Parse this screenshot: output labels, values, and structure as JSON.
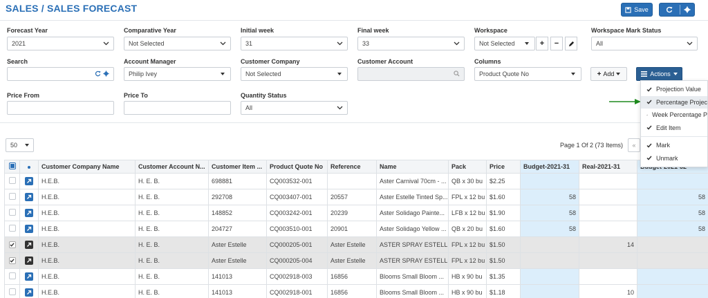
{
  "header": {
    "title": "SALES / SALES FORECAST",
    "save_label": "Save"
  },
  "filters": {
    "forecast_year": {
      "label": "Forecast Year",
      "value": "2021"
    },
    "comparative_year": {
      "label": "Comparative Year",
      "value": "Not Selected"
    },
    "initial_week": {
      "label": "Initial week",
      "value": "31"
    },
    "final_week": {
      "label": "Final week",
      "value": "33"
    },
    "workspace": {
      "label": "Workspace",
      "value": "Not Selected"
    },
    "workspace_mark_status": {
      "label": "Workspace Mark Status",
      "value": "All"
    },
    "search": {
      "label": "Search",
      "value": ""
    },
    "account_manager": {
      "label": "Account Manager",
      "value": "Philip Ivey"
    },
    "customer_company": {
      "label": "Customer Company",
      "value": "Not Selected"
    },
    "customer_account": {
      "label": "Customer Account",
      "value": ""
    },
    "columns": {
      "label": "Columns",
      "value": "Product Quote No"
    },
    "price_from": {
      "label": "Price From",
      "value": ""
    },
    "price_to": {
      "label": "Price To",
      "value": ""
    },
    "quantity_status": {
      "label": "Quantity Status",
      "value": "All"
    }
  },
  "toolbar": {
    "add_label": "Add",
    "actions_label": "Actions"
  },
  "actions_menu": {
    "items": [
      "Projection Value",
      "Percentage Projec",
      "Week Percentage P",
      "Edit Item",
      "Mark",
      "Unmark"
    ]
  },
  "pagination": {
    "page_size": "50",
    "page_info": "Page 1 Of 2 (73 Items)",
    "first_label": "«"
  },
  "table": {
    "headers": [
      "Customer Company Name",
      "Customer Account N...",
      "Customer Item ...",
      "Product Quote No",
      "Reference",
      "Name",
      "Pack",
      "Price",
      "Budget-2021-31",
      "Real-2021-31",
      "Budget-2021-32"
    ],
    "rows": [
      {
        "company": "H.E.B.",
        "account": "H. E. B.",
        "item": "698881",
        "quote": "CQ003532-001",
        "reference": "",
        "name": "Aster Carnival 70cm - ...",
        "pack": "QB x 30 bu",
        "price": "$2.25",
        "budget31": "",
        "real31": "",
        "budget32": ""
      },
      {
        "company": "H.E.B.",
        "account": "H. E. B.",
        "item": "292708",
        "quote": "CQ003407-001",
        "reference": "20557",
        "name": "Aster Estelle Tinted Sp...",
        "pack": "FPL x 12 bu",
        "price": "$1.60",
        "budget31": "58",
        "real31": "",
        "budget32": "58"
      },
      {
        "company": "H.E.B.",
        "account": "H. E. B.",
        "item": "148852",
        "quote": "CQ003242-001",
        "reference": "20239",
        "name": "Aster Solidago Painte...",
        "pack": "LFB x 12 bu",
        "price": "$1.90",
        "budget31": "58",
        "real31": "",
        "budget32": "58"
      },
      {
        "company": "H.E.B.",
        "account": "H. E. B.",
        "item": "204727",
        "quote": "CQ003510-001",
        "reference": "20901",
        "name": "Aster Solidago Yellow ...",
        "pack": "QB x 20 bu",
        "price": "$1.60",
        "budget31": "58",
        "real31": "",
        "budget32": "58"
      },
      {
        "company": "H.E.B.",
        "account": "H. E. B.",
        "item": "Aster Estelle",
        "quote": "CQ000205-001",
        "reference": "Aster Estelle",
        "name": "ASTER SPRAY ESTELLE",
        "pack": "FPL x 12 bu",
        "price": "$1.50",
        "budget31": "",
        "real31": "14",
        "budget32": ""
      },
      {
        "company": "H.E.B.",
        "account": "H. E. B.",
        "item": "Aster Estelle",
        "quote": "CQ000205-004",
        "reference": "Aster Estelle",
        "name": "ASTER SPRAY ESTELLE",
        "pack": "FPL x 12 bu",
        "price": "$1.50",
        "budget31": "",
        "real31": "",
        "budget32": ""
      },
      {
        "company": "H.E.B.",
        "account": "H. E. B.",
        "item": "141013",
        "quote": "CQ002918-003",
        "reference": "16856",
        "name": "Blooms Small Bloom ...",
        "pack": "HB x 90 bu",
        "price": "$1.35",
        "budget31": "",
        "real31": "",
        "budget32": ""
      },
      {
        "company": "H.E.B.",
        "account": "H. E. B.",
        "item": "141013",
        "quote": "CQ002918-001",
        "reference": "16856",
        "name": "Blooms Small Bloom ...",
        "pack": "HB x 90 bu",
        "price": "$1.18",
        "budget31": "",
        "real31": "10",
        "budget32": ""
      }
    ]
  },
  "colors": {
    "primary": "#2a6fb6",
    "budget_bg": "#dceefb",
    "selected_row": "#e6e6e6",
    "arrow": "#1e8a1e"
  }
}
